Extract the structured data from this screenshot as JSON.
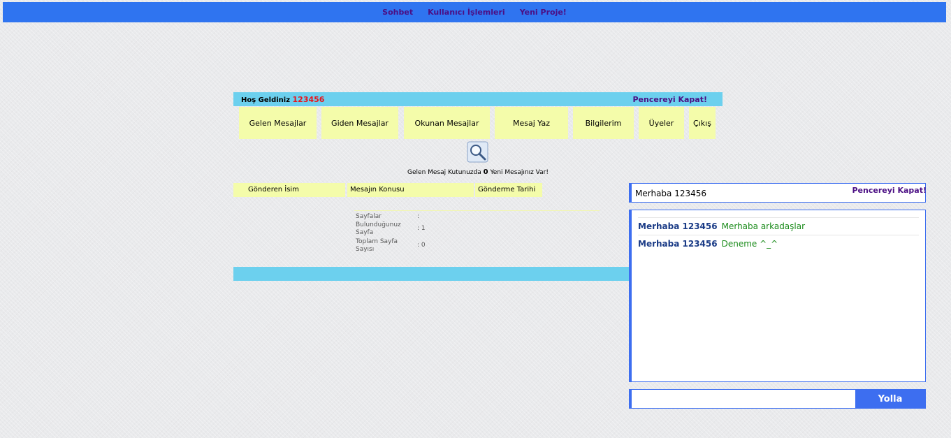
{
  "topnav": {
    "items": [
      "Sohbet",
      "Kullanıcı İşlemleri",
      "Yeni Proje!"
    ]
  },
  "welcome": {
    "greeting": "Hoş Geldiniz",
    "username": "123456",
    "close": "Pencereyi Kapat!"
  },
  "menu": [
    "Gelen Mesajlar",
    "Giden Mesajlar",
    "Okunan Mesajlar",
    "Mesaj Yaz",
    "Bilgilerim",
    "Üyeler",
    "Çıkış"
  ],
  "inbox": {
    "prefix": "Gelen Mesaj Kutunuzda",
    "count": "0",
    "suffix": "Yeni Mesajınız Var!"
  },
  "table": {
    "columns": [
      "Gönderen İsim",
      "Mesajın Konusu",
      "Gönderme Tarihi"
    ]
  },
  "pager": {
    "rows": [
      {
        "label": "Sayfalar",
        "value": ":"
      },
      {
        "label": "Bulunduğunuz Sayfa",
        "value": ": 1"
      },
      {
        "label": "Toplam Sayfa Sayısı",
        "value": ": 0"
      }
    ]
  },
  "chat": {
    "header": "Merhaba 123456",
    "close": "Pencereyi Kapat!",
    "messages": [
      {
        "who": "Merhaba 123456",
        "text": "Merhaba arkadaşlar"
      },
      {
        "who": "Merhaba 123456",
        "text": "Deneme ^_^"
      }
    ],
    "input_value": "",
    "send_label": "Yolla"
  },
  "colors": {
    "nav": "#2f74f0",
    "bar": "#6cd0ee",
    "button": "#f4fcaa",
    "accent": "#4b0f84",
    "username": "#e8141b"
  }
}
